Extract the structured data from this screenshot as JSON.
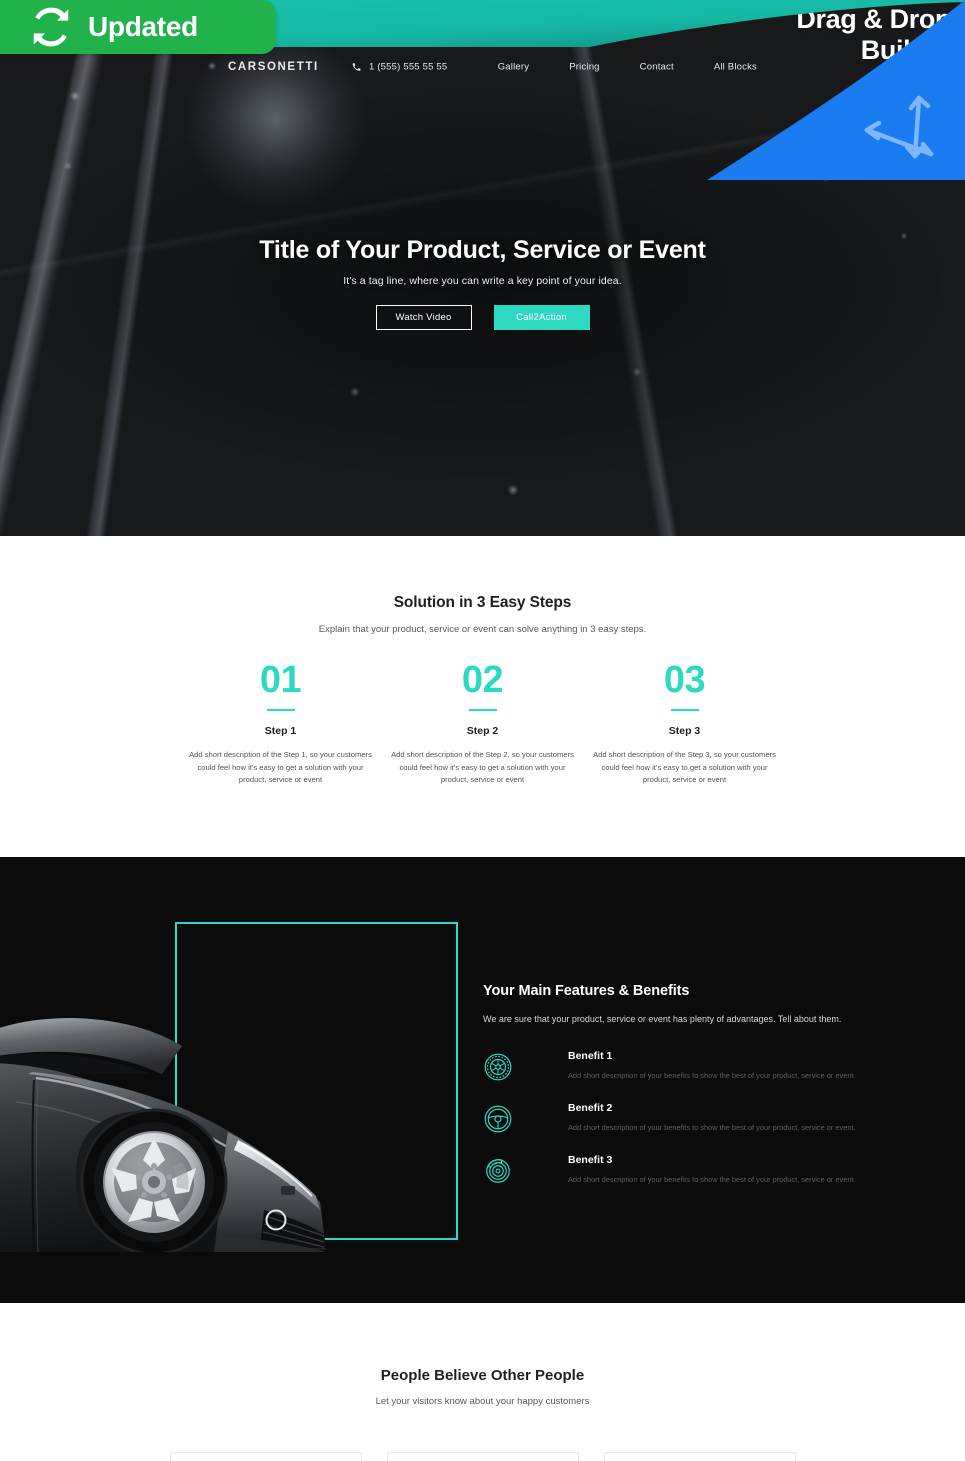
{
  "promo": {
    "updated_badge": "Updated",
    "updated_icon": "refresh-icon",
    "ribbon_line1": "Drag & Drop",
    "ribbon_line2": "Builder",
    "ribbon_icon": "four-way-arrow-icon",
    "ribbon_color": "#1a7cf0",
    "badge_color": "#21b24c"
  },
  "theme": {
    "accent": "#2ed9c3",
    "dark_section": "#0b0b0b",
    "heading": "#1d2023",
    "body_text": "#55595e"
  },
  "header": {
    "logo": "CARSONETTI",
    "phone_icon": "phone-icon",
    "phone": "1 (555) 555 55 55",
    "nav": [
      {
        "label": "Gallery"
      },
      {
        "label": "Pricing"
      },
      {
        "label": "Contact"
      },
      {
        "label": "All Blocks"
      }
    ]
  },
  "hero": {
    "title": "Title of Your Product, Service or Event",
    "tagline": "It's a tag line, where you can write a key point of your idea.",
    "btn_secondary": "Watch Video",
    "btn_primary": "Call2Action"
  },
  "steps_section": {
    "title": "Solution in 3 Easy Steps",
    "subtitle": "Explain that your product, service or event can solve anything in 3 easy steps.",
    "steps": [
      {
        "number": "01",
        "name": "Step 1",
        "desc": "Add short description of the Step 1, so your customers could feel how it's easy to get a solution with your product, service or event"
      },
      {
        "number": "02",
        "name": "Step 2",
        "desc": "Add short description of the Step 2, so your customers could feel how it's easy to get a solution with your product, service or event"
      },
      {
        "number": "03",
        "name": "Step 3",
        "desc": "Add short description of the Step 3, so your customers could feel how it's easy to get a solution with your product, service or event"
      }
    ]
  },
  "features_section": {
    "title": "Your Main Features & Benefits",
    "subtitle": "We are sure that your product, service or event has plenty of advantages. Tell about them.",
    "image_alt": "black-sports-car-front-view",
    "benefits": [
      {
        "icon": "tire-wheel-icon",
        "name": "Benefit 1",
        "desc": "Add short description of your benefits to show the best of your product, service or event."
      },
      {
        "icon": "steering-wheel-icon",
        "name": "Benefit 2",
        "desc": "Add short description of your benefits to show the best of your product, service or event."
      },
      {
        "icon": "brake-disc-icon",
        "name": "Benefit 3",
        "desc": "Add short description of your benefits to show the best of your product, service or event."
      }
    ]
  },
  "testimonials_section": {
    "title": "People Believe Other People",
    "subtitle": "Let your visitors know about your happy customers"
  }
}
